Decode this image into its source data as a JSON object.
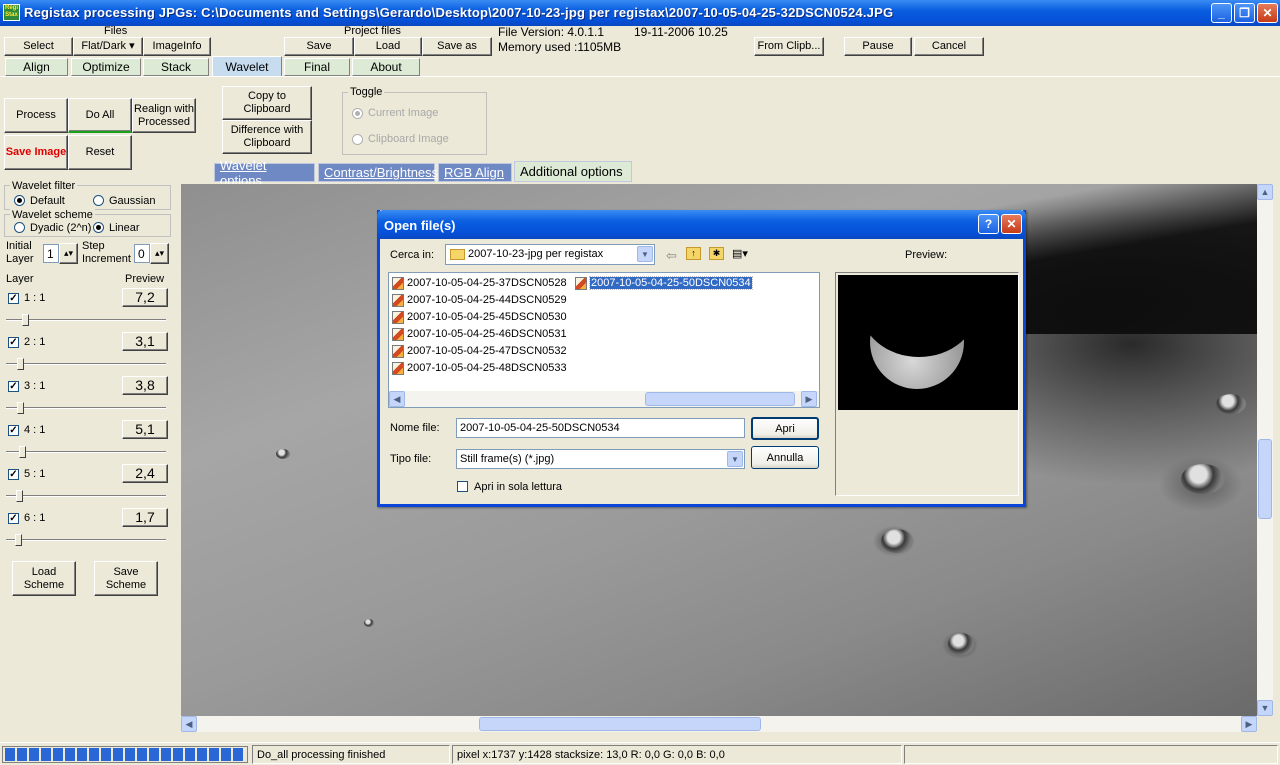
{
  "window": {
    "title": "Registax processing JPGs: C:\\Documents and Settings\\Gerardo\\Desktop\\2007-10-23-jpg per registax\\2007-10-05-04-25-32DSCN0524.JPG",
    "app_icon_text": "Regi Stax",
    "min": "_",
    "max": "❐",
    "close": "✕"
  },
  "toolbar": {
    "files_label": "Files",
    "select": "Select",
    "flatdark": "Flat/Dark ▾",
    "imageinfo": "ImageInfo",
    "project_label": "Project files",
    "save": "Save",
    "load": "Load",
    "save_as": "Save as",
    "file_version": "File Version: 4.0.1.1",
    "file_date": "19-11-2006 10.25",
    "memory": "Memory used :1105MB",
    "from_clip": "From Clipb...",
    "pause": "Pause",
    "cancel": "Cancel"
  },
  "tabs": [
    "Align",
    "Optimize",
    "Stack",
    "Wavelet",
    "Final",
    "About"
  ],
  "actions": {
    "process": "Process",
    "do_all": "Do All",
    "realign": "Realign with Processed",
    "save_image": "Save Image",
    "reset": "Reset",
    "copy_clip": "Copy to Clipboard",
    "diff_clip": "Difference with Clipboard",
    "toggle_label": "Toggle",
    "current_image": "Current Image",
    "clipboard_image": "Clipboard Image"
  },
  "subtabs": [
    "Wavelet options",
    "Contrast/Brightness",
    "RGB Align",
    "Additional options"
  ],
  "wavelet": {
    "filter_label": "Wavelet filter",
    "default": "Default",
    "gaussian": "Gaussian",
    "scheme_label": "Wavelet scheme",
    "dyadic": "Dyadic (2^n)",
    "linear": "Linear",
    "initial_layer_label": "Initial Layer",
    "initial_layer": "1",
    "step_label": "Step Increment",
    "step": "0",
    "layer_label": "Layer",
    "preview_label": "Preview",
    "layers": [
      {
        "label": "1 : 1",
        "value": "7,2"
      },
      {
        "label": "2 : 1",
        "value": "3,1"
      },
      {
        "label": "3 : 1",
        "value": "3,8"
      },
      {
        "label": "4 : 1",
        "value": "5,1"
      },
      {
        "label": "5 : 1",
        "value": "2,4"
      },
      {
        "label": "6 : 1",
        "value": "1,7"
      }
    ],
    "load_scheme": "Load Scheme",
    "save_scheme": "Save Scheme"
  },
  "dialog": {
    "title": "Open file(s)",
    "help": "?",
    "close": "✕",
    "look_in_label": "Cerca in:",
    "look_in": "2007-10-23-jpg per registax",
    "preview_label": "Preview:",
    "files": [
      "2007-10-05-04-25-37DSCN0528",
      "2007-10-05-04-25-44DSCN0529",
      "2007-10-05-04-25-45DSCN0530",
      "2007-10-05-04-25-46DSCN0531",
      "2007-10-05-04-25-47DSCN0532",
      "2007-10-05-04-25-48DSCN0533"
    ],
    "selected_file": "2007-10-05-04-25-50DSCN0534",
    "filename_label": "Nome file:",
    "filename": "2007-10-05-04-25-50DSCN0534",
    "filetype_label": "Tipo file:",
    "filetype": "Still frame(s) (*.jpg)",
    "open": "Apri",
    "cancel": "Annulla",
    "readonly": "Apri in sola lettura"
  },
  "status": {
    "message": "Do_all processing finished",
    "pixel": "pixel x:1737 y:1428 stacksize: 13,0 R: 0,0 G: 0,0 B: 0,0"
  }
}
